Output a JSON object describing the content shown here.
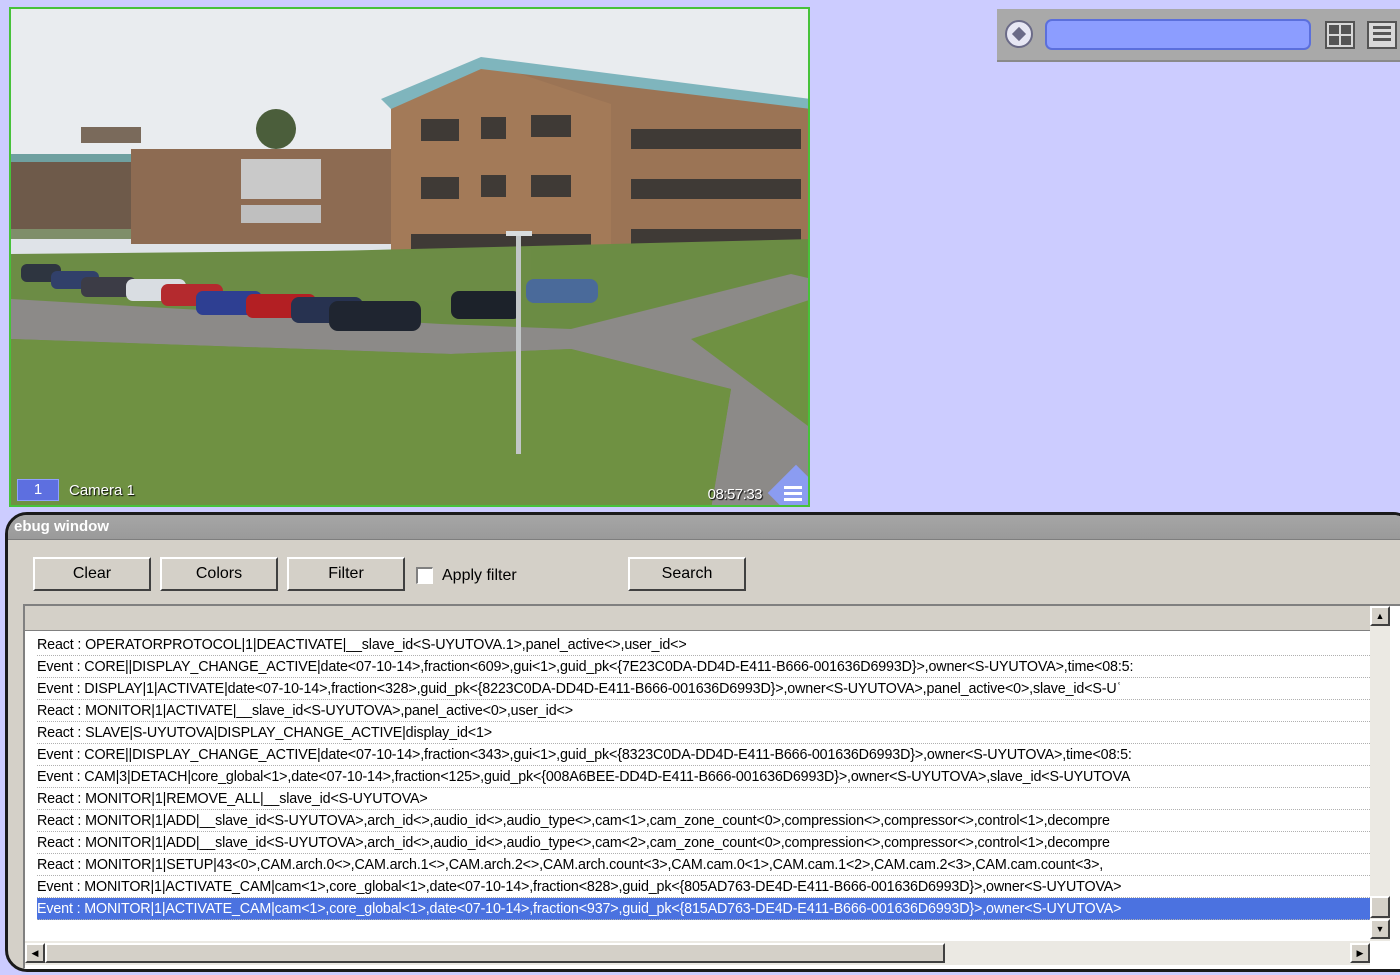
{
  "camera": {
    "number": "1",
    "name": "Camera 1",
    "time": "08:57:33",
    "border_color": "#47c23a"
  },
  "panel": {
    "icons": [
      "camera-selector-icon",
      "layout-grid-icon",
      "menu-list-icon"
    ]
  },
  "debug": {
    "title": "ebug window",
    "buttons": {
      "clear": "Clear",
      "colors": "Colors",
      "filter": "Filter",
      "search": "Search"
    },
    "apply_filter_label": "Apply filter",
    "apply_filter_checked": false,
    "lines": [
      "React : OPERATORPROTOCOL|1|DEACTIVATE|__slave_id<S-UYUTOVA.1>,panel_active<>,user_id<>",
      "Event : CORE||DISPLAY_CHANGE_ACTIVE|date<07-10-14>,fraction<609>,gui<1>,guid_pk<{7E23C0DA-DD4D-E411-B666-001636D6993D}>,owner<S-UYUTOVA>,time<08:5:",
      "Event : DISPLAY|1|ACTIVATE|date<07-10-14>,fraction<328>,guid_pk<{8223C0DA-DD4D-E411-B666-001636D6993D}>,owner<S-UYUTOVA>,panel_active<0>,slave_id<S-Uʿ",
      "React : MONITOR|1|ACTIVATE|__slave_id<S-UYUTOVA>,panel_active<0>,user_id<>",
      "React : SLAVE|S-UYUTOVA|DISPLAY_CHANGE_ACTIVE|display_id<1>",
      "Event : CORE||DISPLAY_CHANGE_ACTIVE|date<07-10-14>,fraction<343>,gui<1>,guid_pk<{8323C0DA-DD4D-E411-B666-001636D6993D}>,owner<S-UYUTOVA>,time<08:5:",
      "Event : CAM|3|DETACH|core_global<1>,date<07-10-14>,fraction<125>,guid_pk<{008A6BEE-DD4D-E411-B666-001636D6993D}>,owner<S-UYUTOVA>,slave_id<S-UYUTOVA",
      "React : MONITOR|1|REMOVE_ALL|__slave_id<S-UYUTOVA>",
      "React : MONITOR|1|ADD|__slave_id<S-UYUTOVA>,arch_id<>,audio_id<>,audio_type<>,cam<1>,cam_zone_count<0>,compression<>,compressor<>,control<1>,decompre",
      "React : MONITOR|1|ADD|__slave_id<S-UYUTOVA>,arch_id<>,audio_id<>,audio_type<>,cam<2>,cam_zone_count<0>,compression<>,compressor<>,control<1>,decompre",
      "React : MONITOR|1|SETUP|43<0>,CAM.arch.0<>,CAM.arch.1<>,CAM.arch.2<>,CAM.arch.count<3>,CAM.cam.0<1>,CAM.cam.1<2>,CAM.cam.2<3>,CAM.cam.count<3>,",
      "Event : MONITOR|1|ACTIVATE_CAM|cam<1>,core_global<1>,date<07-10-14>,fraction<828>,guid_pk<{805AD763-DE4D-E411-B666-001636D6993D}>,owner<S-UYUTOVA>",
      "Event : MONITOR|1|ACTIVATE_CAM|cam<1>,core_global<1>,date<07-10-14>,fraction<937>,guid_pk<{815AD763-DE4D-E411-B666-001636D6993D}>,owner<S-UYUTOVA>"
    ],
    "selected_index": 12,
    "selection_color": "#4b72e0"
  },
  "scrollbar": {
    "up_arrow": "▲",
    "down_arrow": "▼",
    "left_arrow": "◀",
    "right_arrow": "▶"
  }
}
